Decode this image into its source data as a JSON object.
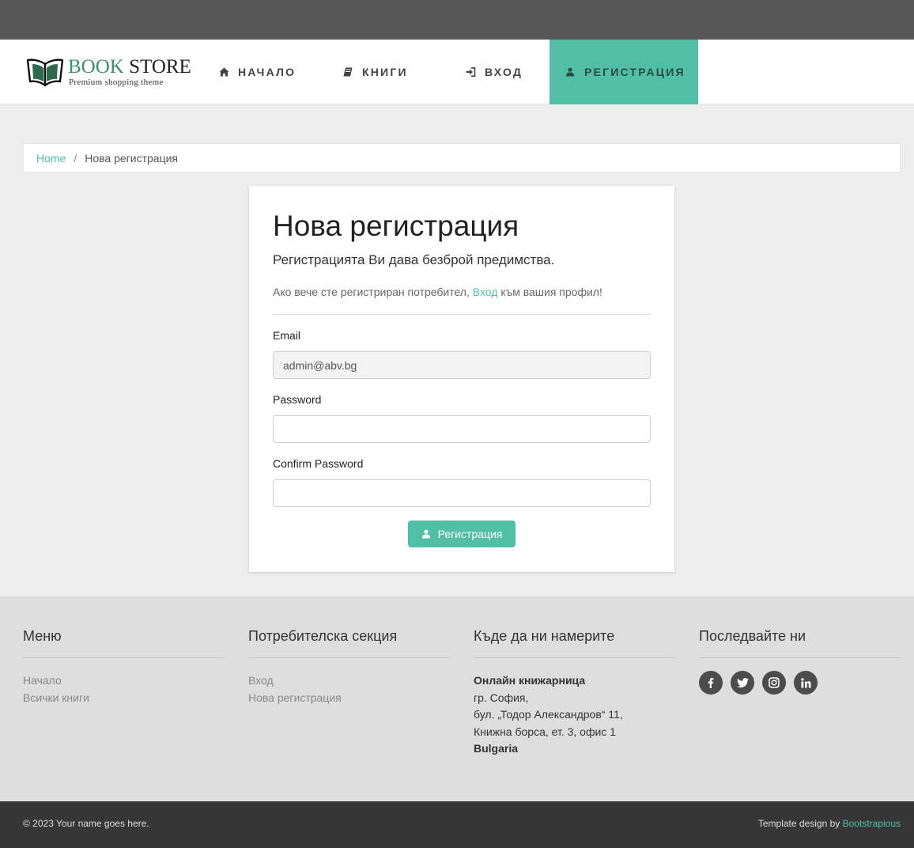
{
  "logo": {
    "title_part1": "BOOK",
    "title_part2": " STORE",
    "subtitle": "Premium shopping theme"
  },
  "nav": {
    "items": [
      {
        "label": "НАЧАЛО",
        "icon": "home-icon"
      },
      {
        "label": "КНИГИ",
        "icon": "book-icon"
      },
      {
        "label": "ВХОД",
        "icon": "sign-in-icon"
      },
      {
        "label": "РЕГИСТРАЦИЯ",
        "icon": "user-icon",
        "active": true
      }
    ]
  },
  "breadcrumb": {
    "home": "Home",
    "separator": "/",
    "current": "Нова регистрация"
  },
  "form": {
    "title": "Нова регистрация",
    "lead": "Регистрацията Ви дава безброй предимства.",
    "note_before": "Ако вече сте регистриран потребител, ",
    "note_link": "Вход",
    "note_after": " към вашия профил!",
    "email_label": "Email",
    "email_value": "admin@abv.bg",
    "password_label": "Password",
    "password_value": "",
    "confirm_label": "Confirm Password",
    "confirm_value": "",
    "submit_label": "Регистрация"
  },
  "footer": {
    "menu": {
      "title": "Меню",
      "links": [
        "Начало",
        "Всички книги"
      ]
    },
    "user": {
      "title": "Потребителска секция",
      "links": [
        "Вход",
        "Нова регистрация"
      ]
    },
    "location": {
      "title": "Къде да ни намерите",
      "name": "Онлайн книжарница",
      "city": "гр. София,",
      "street": "бул. „Тодор Александров“ 11,",
      "building": "Книжна борса, ет. 3, офис 1",
      "country": "Bulgaria"
    },
    "follow": {
      "title": "Последвайте ни",
      "icons": [
        "facebook-icon",
        "twitter-icon",
        "instagram-icon",
        "linkedin-icon"
      ]
    }
  },
  "bottom": {
    "copyright": "© 2023 Your name goes here.",
    "credit_text": "Template design by ",
    "credit_link": "Bootstrapious"
  },
  "colors": {
    "accent": "#50bfa5",
    "topbar": "#575757",
    "bottombar": "#363636",
    "footer": "#dedede"
  }
}
